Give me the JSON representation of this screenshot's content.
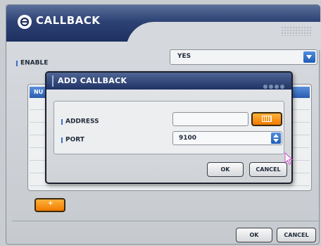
{
  "window": {
    "title": "CALLBACK",
    "title_icon": "power-circle-icon"
  },
  "enable": {
    "label": "ENABLE",
    "value": "YES"
  },
  "list": {
    "header_label": "NU"
  },
  "add_button": {
    "label": "+"
  },
  "footer": {
    "ok_label": "OK",
    "cancel_label": "CANCEL"
  },
  "dialog": {
    "title": "ADD CALLBACK",
    "address_label": "ADDRESS",
    "address_value": "",
    "keyboard_icon": "keyboard-icon",
    "port_label": "PORT",
    "port_value": "9100",
    "ok_label": "OK",
    "cancel_label": "CANCEL"
  },
  "colors": {
    "title_blue": "#1e3060",
    "accent_blue": "#1e5cb8",
    "orange": "#f07a00"
  }
}
